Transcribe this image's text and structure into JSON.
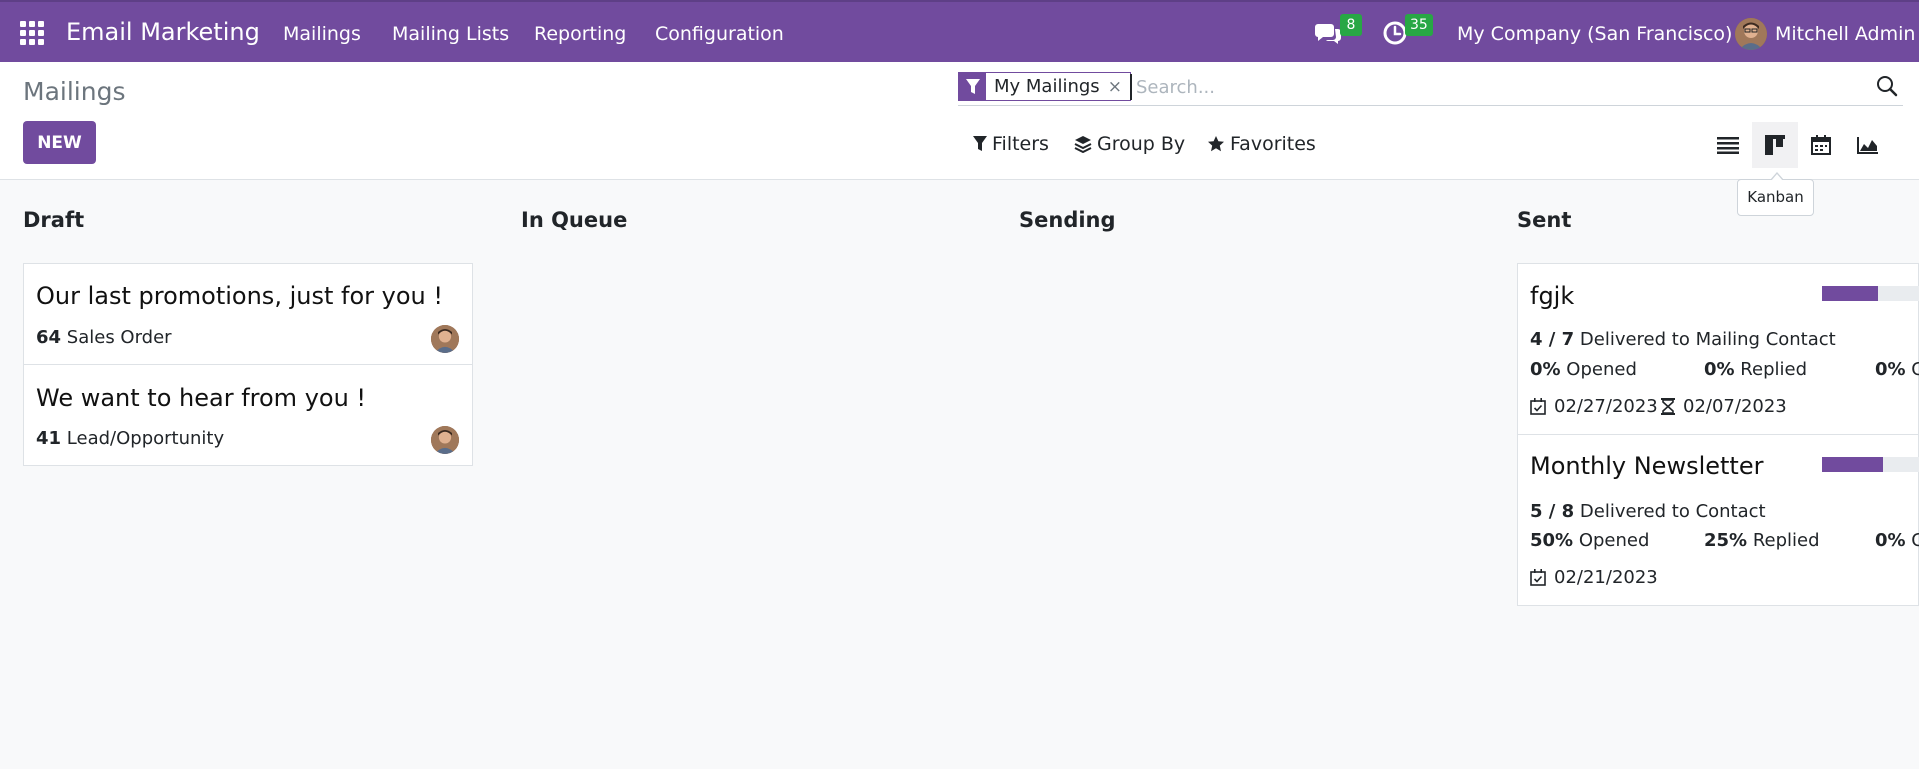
{
  "navbar": {
    "brand": "Email Marketing",
    "menus": [
      "Mailings",
      "Mailing Lists",
      "Reporting",
      "Configuration"
    ],
    "messages_count": "8",
    "activities_count": "35",
    "company": "My Company (San Francisco)",
    "user": "Mitchell Admin",
    "bg_color": "#714b9e"
  },
  "control": {
    "breadcrumb": "Mailings",
    "new_label": "NEW",
    "facet_label": "My Mailings",
    "facet_close": "×",
    "search_placeholder": "Search...",
    "filters_label": "Filters",
    "groupby_label": "Group By",
    "favorites_label": "Favorites",
    "views": [
      "list-icon",
      "kanban-icon",
      "calendar-icon",
      "graph-icon"
    ],
    "active_view": "kanban",
    "tooltip": "Kanban"
  },
  "kanban": {
    "columns": [
      {
        "title": "Draft",
        "cards": [
          {
            "title": "Our last promotions, just for you !",
            "count": "64",
            "model": "Sales Order"
          },
          {
            "title": "We want to hear from you !",
            "count": "41",
            "model": "Lead/Opportunity"
          }
        ]
      },
      {
        "title": "In Queue",
        "cards": []
      },
      {
        "title": "Sending",
        "cards": []
      },
      {
        "title": "Sent",
        "cards": [
          {
            "title": "fgjk",
            "delivered": "4 / 7",
            "delivered_to": "Delivered to Mailing Contact",
            "progress": 0.57,
            "opened": "0%",
            "opened_label": "Opened",
            "replied": "0%",
            "replied_label": "Replied",
            "clicked": "0%",
            "clicked_label": "C",
            "sent_date": "02/27/2023",
            "schedule_date": "02/07/2023"
          },
          {
            "title": "Monthly Newsletter",
            "delivered": "5 / 8",
            "delivered_to": "Delivered to Contact",
            "progress": 0.625,
            "opened": "50%",
            "opened_label": "Opened",
            "replied": "25%",
            "replied_label": "Replied",
            "clicked": "0%",
            "clicked_label": "C",
            "sent_date": "02/21/2023"
          }
        ]
      }
    ]
  }
}
